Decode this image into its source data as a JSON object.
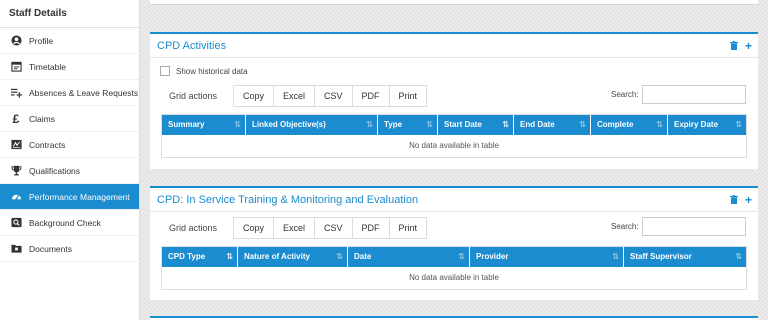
{
  "sidebar": {
    "title": "Staff Details",
    "items": [
      {
        "label": "Profile",
        "icon": "user-circle-icon",
        "active": false
      },
      {
        "label": "Timetable",
        "icon": "calendar-icon",
        "active": false
      },
      {
        "label": "Absences & Leave Requests",
        "icon": "list-plus-icon",
        "active": false
      },
      {
        "label": "Claims",
        "icon": "pound-icon",
        "active": false
      },
      {
        "label": "Contracts",
        "icon": "signature-icon",
        "active": false
      },
      {
        "label": "Qualifications",
        "icon": "trophy-icon",
        "active": false
      },
      {
        "label": "Performance Management",
        "icon": "gauge-icon",
        "active": true
      },
      {
        "label": "Background Check",
        "icon": "search-box-icon",
        "active": false
      },
      {
        "label": "Documents",
        "icon": "folder-icon",
        "active": false
      }
    ]
  },
  "cpd_activities": {
    "title": "CPD Activities",
    "show_historical_label": "Show historical data",
    "grid_actions_label": "Grid actions",
    "buttons": [
      "Copy",
      "Excel",
      "CSV",
      "PDF",
      "Print"
    ],
    "search_label": "Search:",
    "columns": [
      "Summary",
      "Linked Objective(s)",
      "Type",
      "Start Date",
      "End Date",
      "Complete",
      "Expiry Date"
    ],
    "empty_message": "No data available in table"
  },
  "cpd_training": {
    "title": "CPD: In Service Training & Monitoring and Evaluation",
    "grid_actions_label": "Grid actions",
    "buttons": [
      "Copy",
      "Excel",
      "CSV",
      "PDF",
      "Print"
    ],
    "search_label": "Search:",
    "columns": [
      "CPD Type",
      "Nature of Activity",
      "Date",
      "Provider",
      "Staff Supervisor"
    ],
    "empty_message": "No data available in table"
  },
  "colors": {
    "accent": "#1a8ccf",
    "active_bg": "#1a8ccf"
  }
}
